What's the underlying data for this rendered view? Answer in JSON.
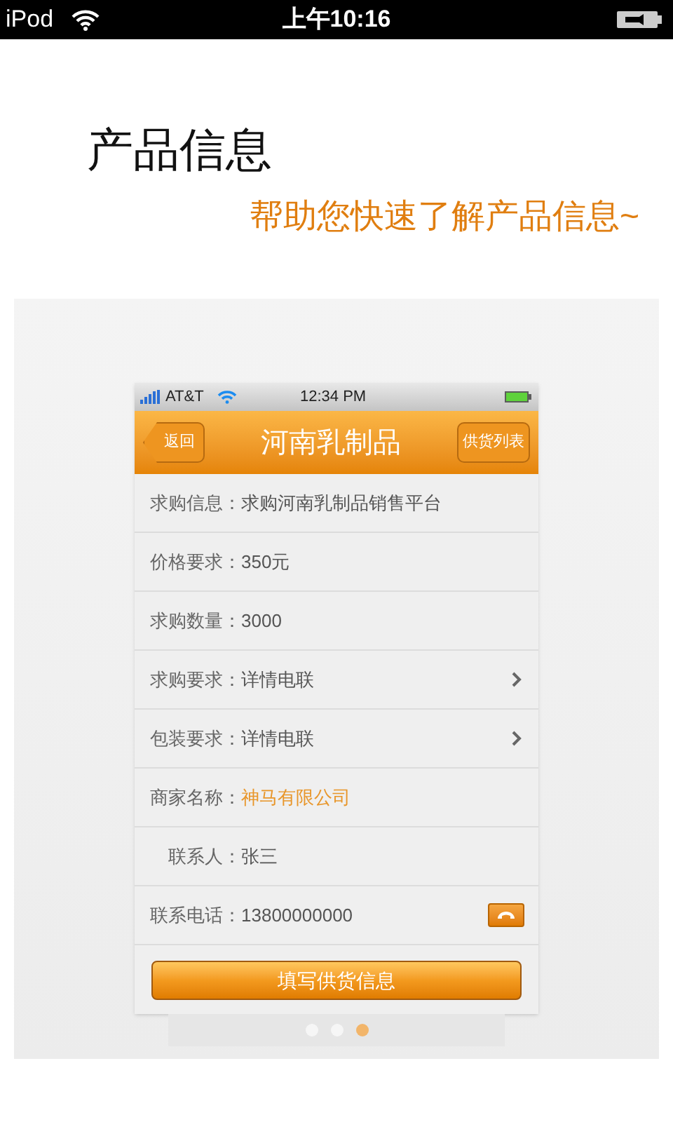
{
  "status_bar": {
    "device": "iPod",
    "time": "上午10:16"
  },
  "heading": {
    "title": "产品信息",
    "subtitle": "帮助您快速了解产品信息~"
  },
  "preview": {
    "status_bar": {
      "carrier": "AT&T",
      "time": "12:34 PM"
    },
    "nav": {
      "back": "返回",
      "title": "河南乳制品",
      "action": "供货列表"
    },
    "rows": [
      {
        "kind": "plain",
        "label": "求购信息：",
        "value": "求购河南乳制品销售平台"
      },
      {
        "kind": "plain",
        "label": "价格要求：",
        "value": "350元"
      },
      {
        "kind": "plain",
        "label": "求购数量：",
        "value": "3000"
      },
      {
        "kind": "more",
        "label": "求购要求：",
        "value": "详情电联"
      },
      {
        "kind": "more",
        "label": "包装要求：",
        "value": "详情电联"
      },
      {
        "kind": "highlight",
        "label": "商家名称：",
        "value": "神马有限公司"
      },
      {
        "kind": "plain",
        "label": "联系人：",
        "value": "张三"
      },
      {
        "kind": "phone",
        "label": "联系电话：",
        "value": "13800000000"
      }
    ],
    "submit": "填写供货信息"
  },
  "pages": [
    {
      "selected": false
    },
    {
      "selected": false
    },
    {
      "selected": true
    }
  ]
}
